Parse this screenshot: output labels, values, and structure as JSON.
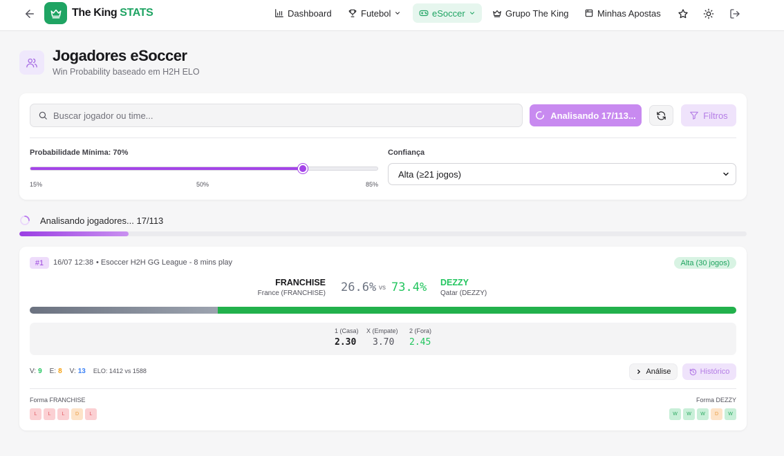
{
  "header": {
    "brand_main": "The King",
    "brand_accent": "STATS",
    "nav": {
      "dashboard": "Dashboard",
      "futebol": "Futebol",
      "esoccer": "eSoccer",
      "grupo": "Grupo The King",
      "apostas": "Minhas Apostas"
    }
  },
  "page": {
    "title": "Jogadores eSoccer",
    "subtitle": "Win Probability baseado em H2H ELO"
  },
  "filters": {
    "search_placeholder": "Buscar jogador ou time...",
    "analyze_button": "Analisando 17/113...",
    "filters_button": "Filtros",
    "min_prob_label": "Probabilidade Mínima: 70%",
    "min_prob_value": 70,
    "slider_min": 15,
    "slider_max": 85,
    "ticks": [
      "15%",
      "50%",
      "85%"
    ],
    "confidence_label": "Confiança",
    "confidence_value": "Alta (≥21 jogos)"
  },
  "progress": {
    "text": "Analisando jogadores... 17/113",
    "done": 17,
    "total": 113
  },
  "match": {
    "rank": "#1",
    "datetime": "16/07 12:38",
    "league": "• Esoccer H2H GG League - 8 mins play",
    "confidence": "Alta (30 jogos)",
    "home": {
      "name": "FRANCHISE",
      "country": "France (FRANCHISE)",
      "prob_text": "26.6%",
      "prob": 26.6
    },
    "vs": "vs",
    "away": {
      "name": "DEZZY",
      "country": "Qatar (DEZZY)",
      "prob_text": "73.4%",
      "prob": 73.4
    },
    "odds": [
      {
        "label": "1 (Casa)",
        "value": "2.30"
      },
      {
        "label": "X (Empate)",
        "value": "3.70"
      },
      {
        "label": "2 (Fora)",
        "value": "2.45"
      }
    ],
    "stats": {
      "v_label": "V:",
      "v_value": "9",
      "e_label": "E:",
      "e_value": "8",
      "v2_label": "V:",
      "v2_value": "13",
      "elo": "ELO: 1412 vs 1588"
    },
    "analise_button": "Análise",
    "historico_button": "Histórico",
    "home_form_label": "Forma FRANCHISE",
    "home_form": [
      "L",
      "L",
      "L",
      "D",
      "L"
    ],
    "away_form_label": "Forma DEZZY",
    "away_form": [
      "W",
      "W",
      "W",
      "D",
      "W"
    ]
  },
  "colors": {
    "brand_green": "#1fa463",
    "purple": "#a445e8",
    "home_pct": "#6b7280",
    "away_pct": "#22c55e"
  }
}
